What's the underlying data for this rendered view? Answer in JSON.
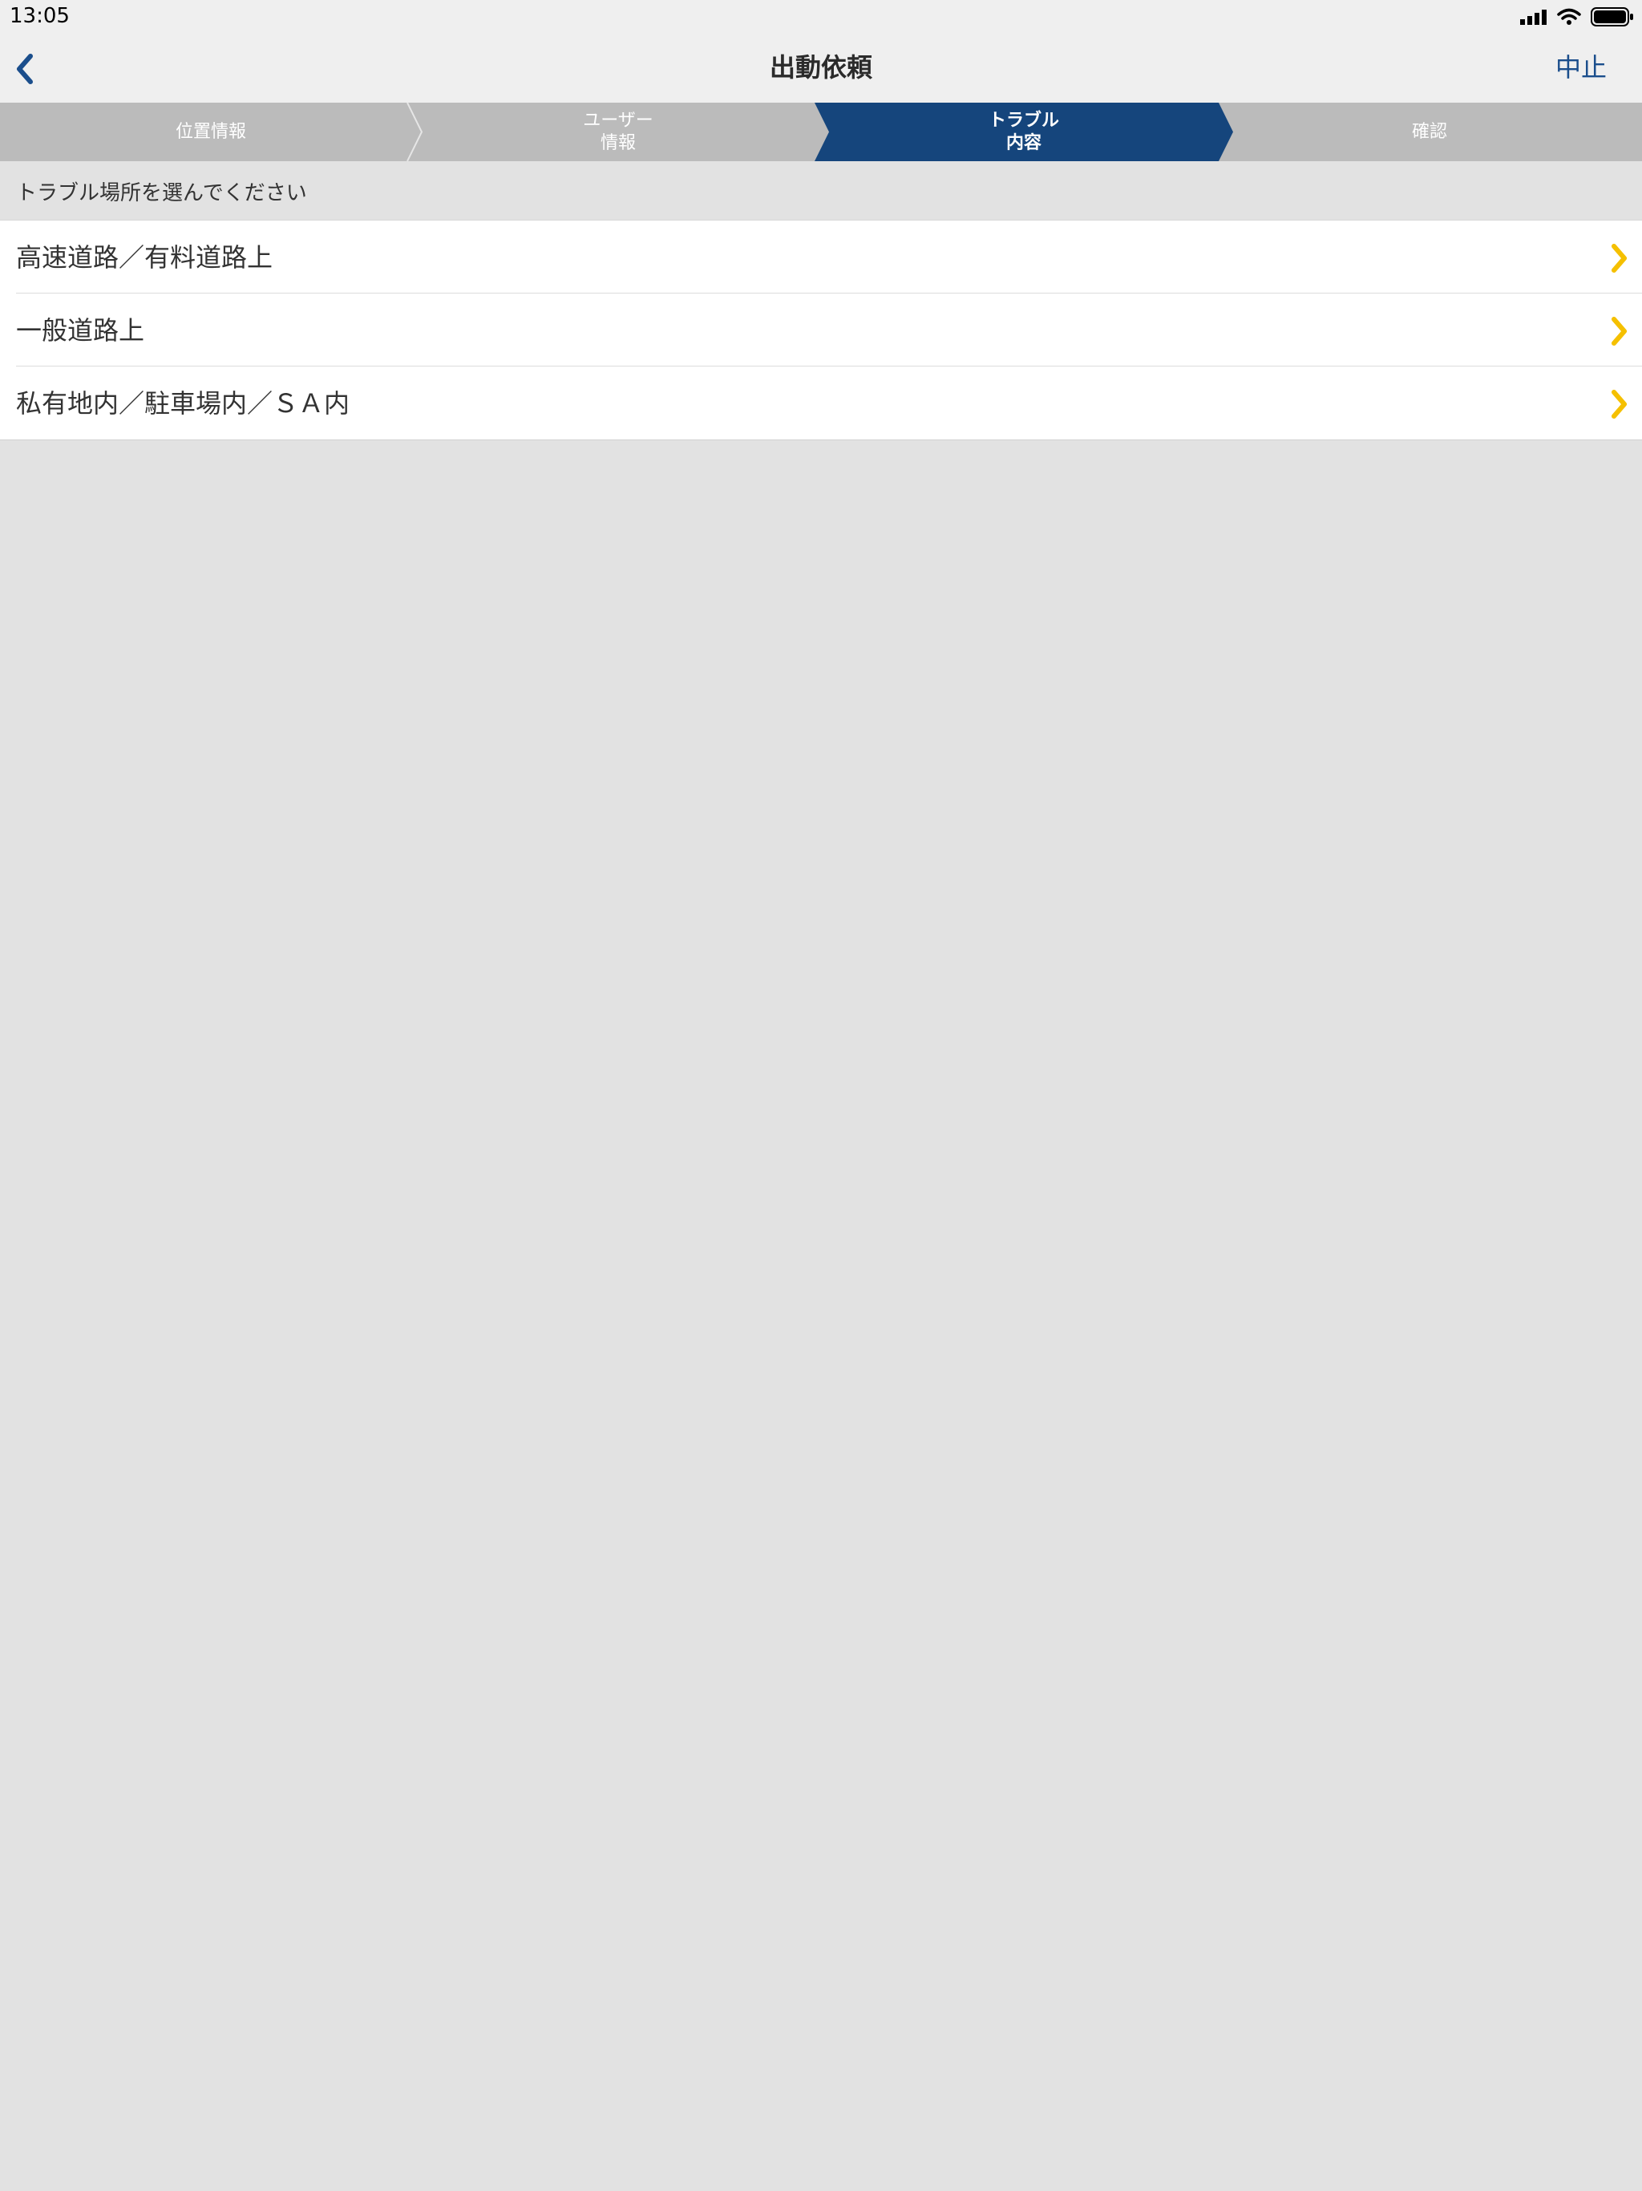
{
  "status_bar": {
    "time": "13:05",
    "icons": [
      "signal-icon",
      "wifi-icon",
      "battery-icon"
    ]
  },
  "nav": {
    "back_icon": "chevron-left-icon",
    "title": "出動依頼",
    "cancel_label": "中止"
  },
  "steps": [
    {
      "label": "位置情報",
      "active": false
    },
    {
      "label": "ユーザー\n情報",
      "active": false
    },
    {
      "label": "トラブル\n内容",
      "active": true
    },
    {
      "label": "確認",
      "active": false
    }
  ],
  "section": {
    "title": "トラブル場所を選んでください"
  },
  "locations": [
    {
      "label": "高速道路／有料道路上"
    },
    {
      "label": "一般道路上"
    },
    {
      "label": "私有地内／駐車場内／ＳＡ内"
    }
  ],
  "colors": {
    "accent": "#1b4e8c",
    "active_step": "#15457c",
    "inactive_step": "#bbbbbb",
    "chevron": "#f5c000",
    "background": "#e2e2e2"
  }
}
